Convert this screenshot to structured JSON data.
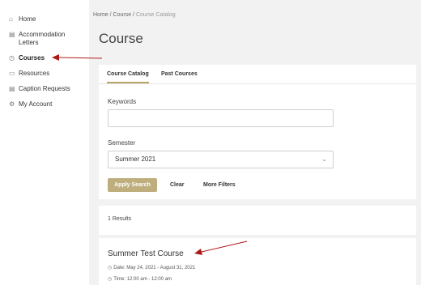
{
  "sidebar": {
    "items": [
      {
        "label": "Home",
        "icon": "home-icon",
        "glyph": "⌂"
      },
      {
        "label": "Accommodation Letters",
        "icon": "letter-icon",
        "glyph": "▤"
      },
      {
        "label": "Courses",
        "icon": "clock-icon",
        "glyph": "◷"
      },
      {
        "label": "Resources",
        "icon": "folder-icon",
        "glyph": "▭"
      },
      {
        "label": "Caption Requests",
        "icon": "caption-icon",
        "glyph": "▤"
      },
      {
        "label": "My Account",
        "icon": "gear-icon",
        "glyph": "⚙"
      }
    ],
    "active": "Courses"
  },
  "breadcrumb": {
    "home": "Home",
    "sep": "/",
    "course": "Course",
    "current": "Course Catalog"
  },
  "page_title": "Course",
  "tabs": [
    {
      "label": "Course Catalog",
      "active": true
    },
    {
      "label": "Past Courses",
      "active": false
    }
  ],
  "form": {
    "keywords_label": "Keywords",
    "keywords_value": "",
    "semester_label": "Semester",
    "semester_value": "Summer 2021",
    "apply_label": "Apply Search",
    "clear_label": "Clear",
    "filters_label": "More Filters"
  },
  "results": {
    "count_text": "1 Results"
  },
  "course": {
    "title": "Summer Test Course",
    "date": "Date: May 24, 2021 - August 31, 2021",
    "time": "Time: 12:00 am - 12:00 am"
  },
  "colors": {
    "accent": "#bfae7d",
    "annotation_arrow": "#b01818"
  }
}
